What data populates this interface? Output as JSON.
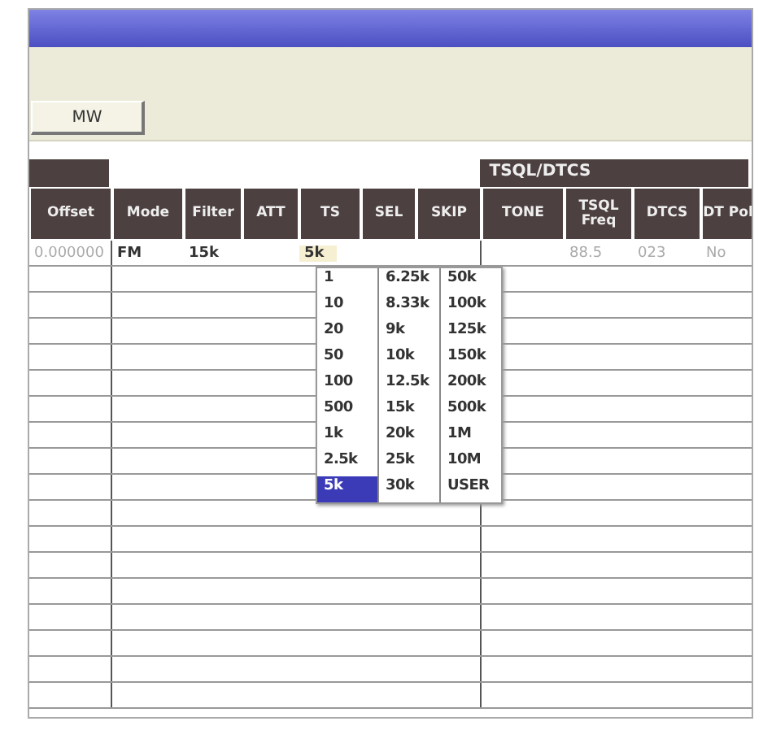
{
  "toolbar": {
    "buttons": [
      {
        "label": "MW"
      }
    ]
  },
  "table": {
    "groups": [
      {
        "columns": [
          {
            "label": "Offset"
          }
        ]
      },
      {
        "columns": [
          {
            "label": "Mode"
          },
          {
            "label": "Filter"
          },
          {
            "label": "ATT"
          },
          {
            "label": "TS"
          },
          {
            "label": "SEL"
          },
          {
            "label": "SKIP"
          }
        ]
      },
      {
        "label": "TSQL/DTCS",
        "columns": [
          {
            "label": "TONE"
          },
          {
            "label": "TSQL Freq"
          },
          {
            "label": "DTCS"
          },
          {
            "label": "DT Pol"
          }
        ]
      }
    ],
    "rows": [
      {
        "cells": [
          {
            "text": "0.000000",
            "disabled": true,
            "selected": false
          },
          {
            "text": "FM",
            "disabled": false,
            "selected": false
          },
          {
            "text": "15k",
            "disabled": false,
            "selected": false
          },
          null,
          {
            "text": "5k",
            "disabled": false,
            "selected": true
          },
          null,
          null,
          null,
          {
            "text": "88.5",
            "disabled": true,
            "selected": false
          },
          {
            "text": "023",
            "disabled": true,
            "selected": false
          },
          {
            "text": "No",
            "disabled": true,
            "selected": false
          }
        ]
      }
    ]
  },
  "dropdown": {
    "columns": [
      [
        {
          "label": "1",
          "selected": false
        },
        {
          "label": "10",
          "selected": false
        },
        {
          "label": "20",
          "selected": false
        },
        {
          "label": "50",
          "selected": false
        },
        {
          "label": "100",
          "selected": false
        },
        {
          "label": "500",
          "selected": false
        },
        {
          "label": "1k",
          "selected": false
        },
        {
          "label": "2.5k",
          "selected": false
        },
        {
          "label": "5k",
          "selected": true
        }
      ],
      [
        {
          "label": "6.25k",
          "selected": false
        },
        {
          "label": "8.33k",
          "selected": false
        },
        {
          "label": "9k",
          "selected": false
        },
        {
          "label": "10k",
          "selected": false
        },
        {
          "label": "12.5k",
          "selected": false
        },
        {
          "label": "15k",
          "selected": false
        },
        {
          "label": "20k",
          "selected": false
        },
        {
          "label": "25k",
          "selected": false
        },
        {
          "label": "30k",
          "selected": false
        }
      ],
      [
        {
          "label": "50k",
          "selected": false
        },
        {
          "label": "100k",
          "selected": false
        },
        {
          "label": "125k",
          "selected": false
        },
        {
          "label": "150k",
          "selected": false
        },
        {
          "label": "200k",
          "selected": false
        },
        {
          "label": "500k",
          "selected": false
        },
        {
          "label": "1M",
          "selected": false
        },
        {
          "label": "10M",
          "selected": false
        },
        {
          "label": "USER",
          "selected": false
        }
      ]
    ]
  }
}
